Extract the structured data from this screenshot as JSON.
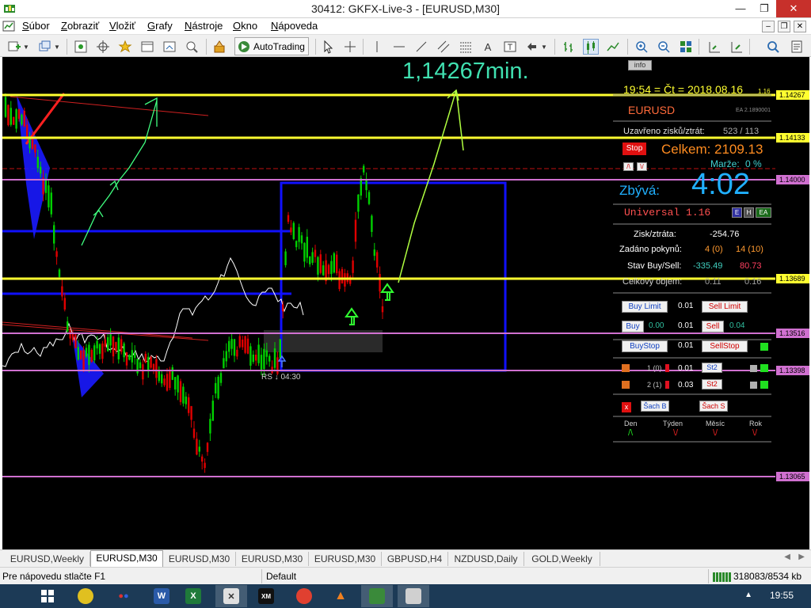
{
  "window": {
    "title": "30412: GKFX-Live-3 - [EURUSD,M30]",
    "minimize": "—",
    "restore": "❐",
    "close": "✕"
  },
  "menu": {
    "items": [
      "Súbor",
      "Zobraziť",
      "Vložiť",
      "Grafy",
      "Nástroje",
      "Okno",
      "Nápoveda"
    ],
    "accel": [
      "S",
      "Z",
      "V",
      "G",
      "N",
      "O",
      "N"
    ],
    "rest": [
      "úbor",
      "obraziť",
      "ložiť",
      "rafy",
      "ástroje",
      "kno",
      "ápoveda"
    ]
  },
  "toolbar": {
    "autotrading_label": "AutoTrading"
  },
  "chart": {
    "annotation_min": "1,14267min.",
    "info_label": "info",
    "rs_label": "RS ↓ 04:30",
    "price_levels": [
      {
        "label": "1.14267",
        "price": 1.14267,
        "color": "#ffff30"
      },
      {
        "label": "1.14133",
        "price": 1.14133,
        "color": "#ffff30"
      },
      {
        "label": "1.14000",
        "price": 1.14,
        "color": "#d070d0"
      },
      {
        "label": "1.13689",
        "price": 1.13689,
        "color": "#ffff30"
      },
      {
        "label": "1.13516",
        "price": 1.13516,
        "color": "#d070d0"
      },
      {
        "label": "1.13398",
        "price": 1.13398,
        "color": "#d070d0"
      },
      {
        "label": "1.13065",
        "price": 1.13065,
        "color": "#d070d0"
      }
    ]
  },
  "panel": {
    "datetime": "19:54 = Čt = 2018.08.16",
    "datetime_suffix": "1.16",
    "symbol": "EURUSD",
    "ea_id": "EA 2.1890001",
    "closed_pl_label": "Uzavřeno zisků/ztrát:",
    "closed_pl_value": "523 / 113",
    "stop_btn": "Stop",
    "total_label": "Celkem:",
    "total_value": "2109.13",
    "margin_label": "Marže:",
    "margin_value": "0 %",
    "remaining_label": "Zbývá:",
    "remaining_value": "4:02",
    "universal_label": "Universal  1.16",
    "mode_e": "E",
    "mode_h": "H",
    "mode_ea": "EA",
    "pl_label": "Zisk/ztráta:",
    "pl_value": "-254.76",
    "orders_label": "Zadáno pokynů:",
    "orders_buy": "4 (0)",
    "orders_sell": "14 (10)",
    "state_label": "Stav Buy/Sell:",
    "state_buy": "-335.49",
    "state_sell": "80.73",
    "volume_label": "Celkový objem:",
    "volume_buy": "0.11",
    "volume_sell": "0.16",
    "buy_limit": "Buy Limit",
    "buy_limit_lot": "0.01",
    "sell_limit": "Sell Limit",
    "buy": "Buy",
    "buy_price": "0.00",
    "buy_lot": "0.01",
    "sell": "Sell",
    "sell_price": "0.04",
    "buy_stop": "BuyStop",
    "buy_stop_lot": "0.01",
    "sell_stop": "SellStop",
    "row1_label": "1 (0)",
    "row1_lot": "0.01",
    "row1_btn": "St2",
    "row2_label": "2 (1)",
    "row2_lot": "0.03",
    "row2_btn": "St2",
    "close_x": "x",
    "sach_b": "Šach B",
    "sach_s": "Šach S",
    "periods": [
      "Den",
      "Týden",
      "Měsíc",
      "Rok"
    ]
  },
  "tabs": [
    "EURUSD,Weekly",
    "EURUSD,M30",
    "EURUSD,M30",
    "EURUSD,M30",
    "EURUSD,M30",
    "GBPUSD,H4",
    "NZDUSD,Daily",
    "GOLD,Weekly"
  ],
  "status": {
    "help": "Pre nápovedu stlačte F1",
    "profile": "Default",
    "traffic": "318083/8534 kb"
  },
  "taskbar": {
    "clock": "19:55"
  },
  "colors": {
    "buy": "#00d000",
    "sell": "#e00000",
    "yellow_line": "#ffff30",
    "pink_line": "#d070d0",
    "box_blue": "#1010ff"
  }
}
